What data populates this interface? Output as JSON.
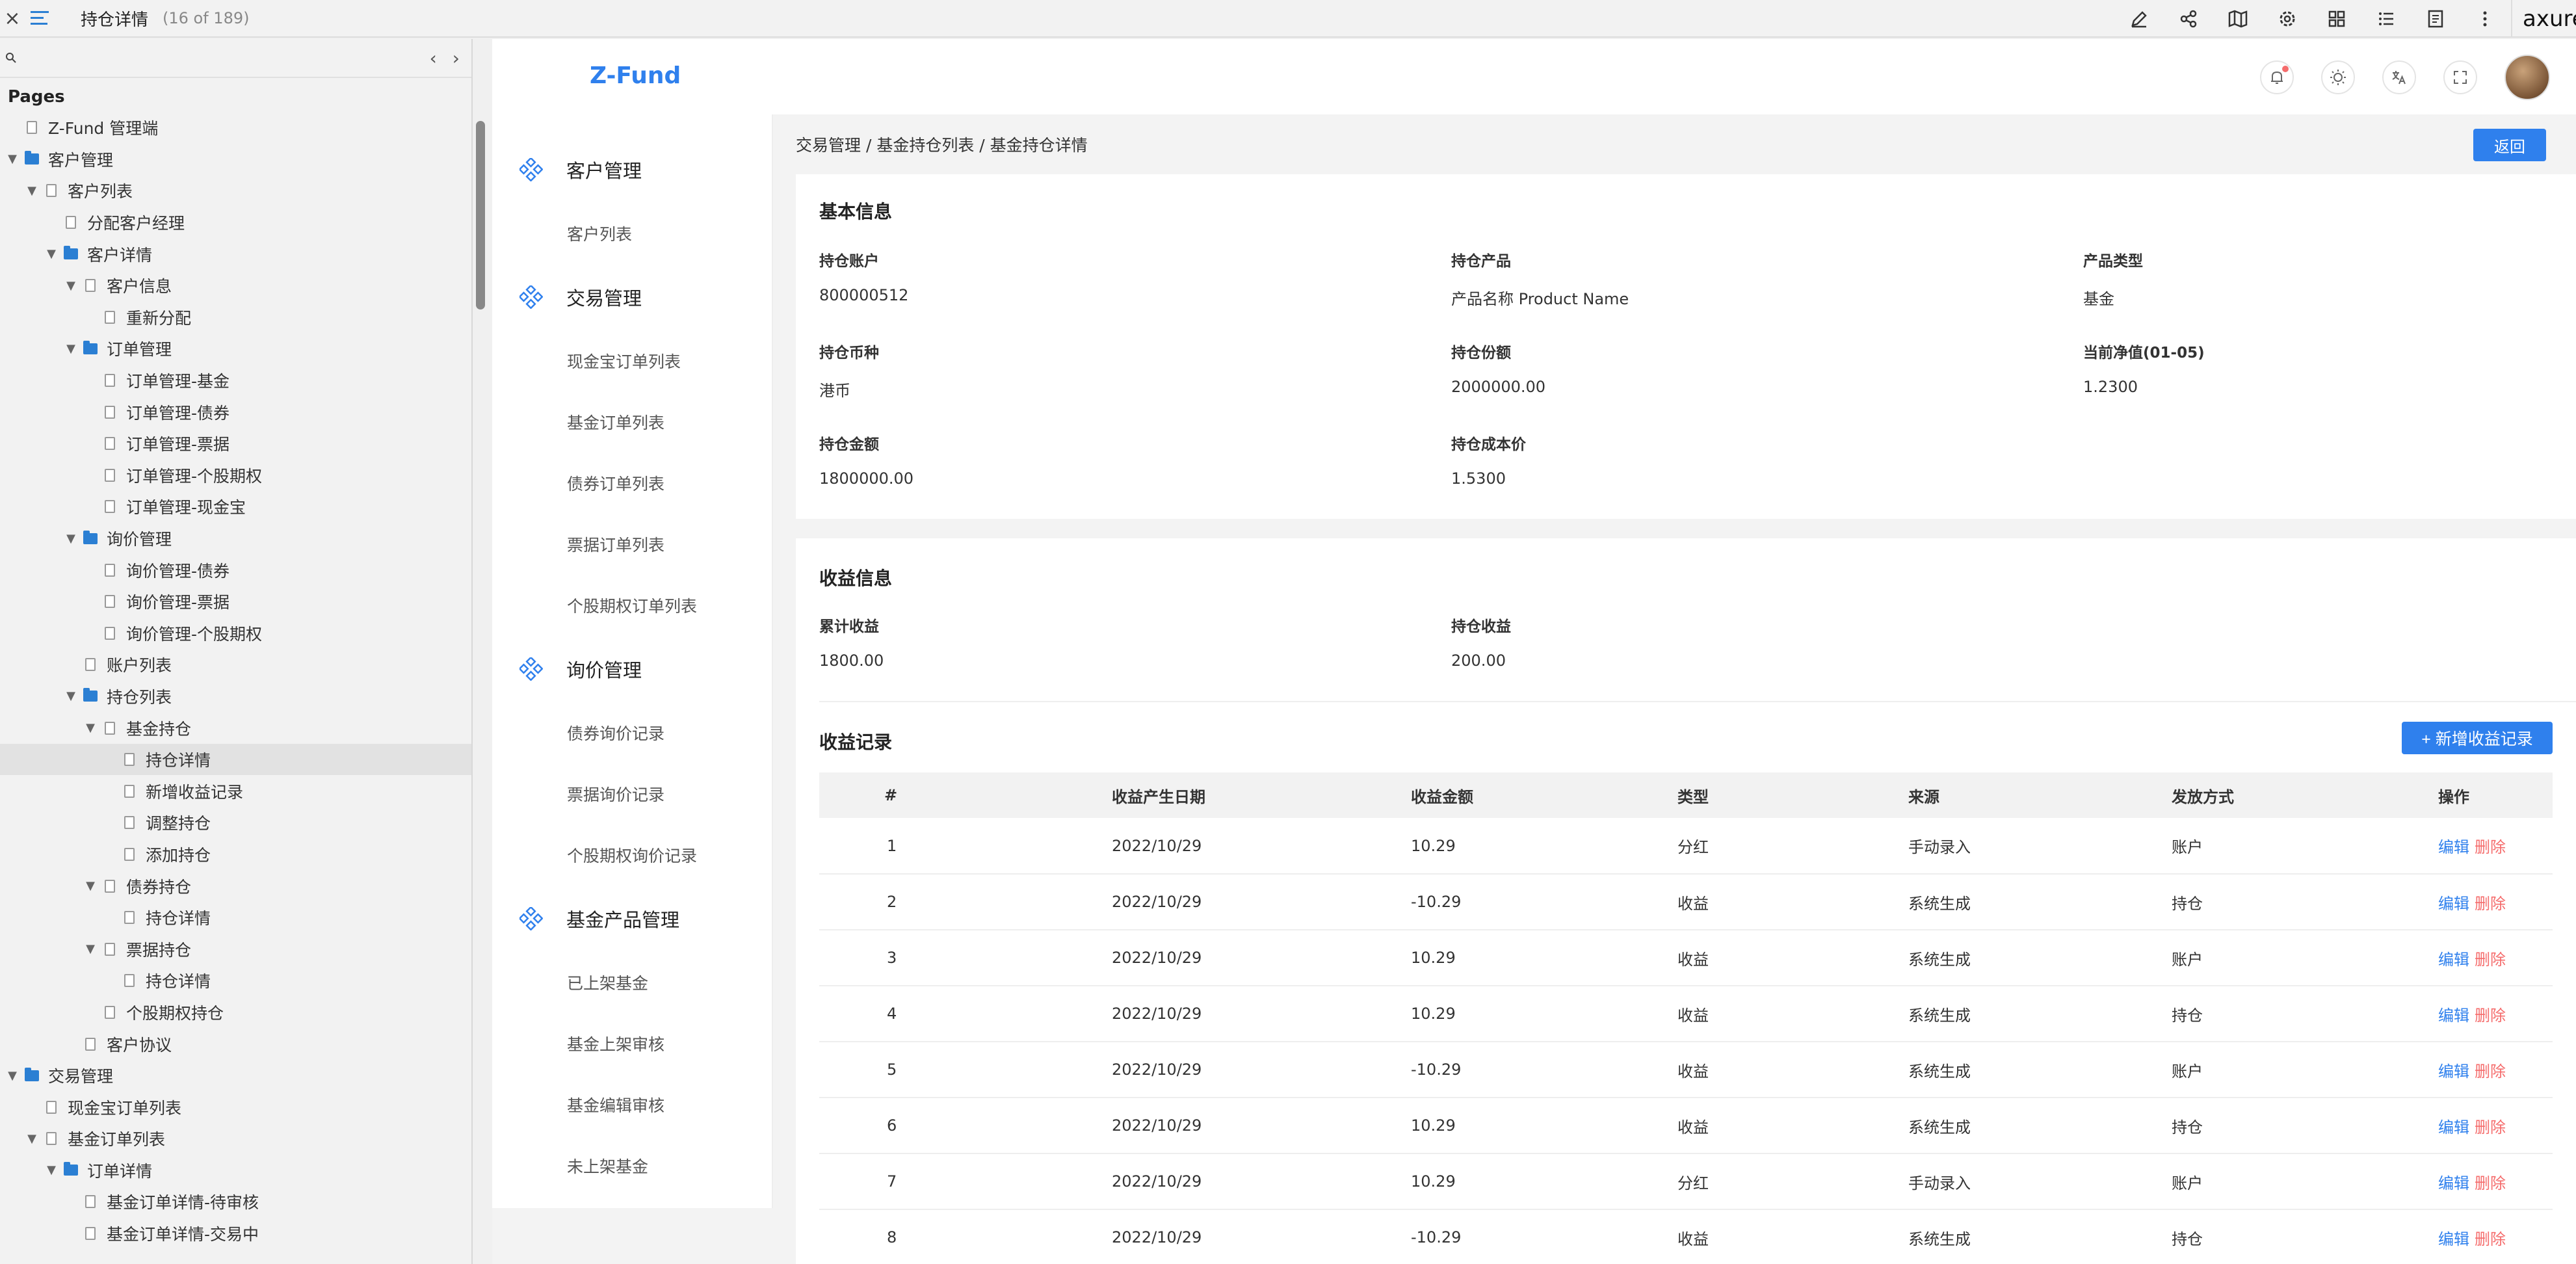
{
  "topbar": {
    "close": "×",
    "title": "持仓详情",
    "count": "(16 of 189)",
    "brand": "axure",
    "tools": [
      "edit-icon",
      "share-icon",
      "map-icon",
      "settings-icon",
      "grid-icon",
      "list-icon",
      "notes-icon",
      "more-icon"
    ]
  },
  "pages_panel": {
    "search_placeholder": "",
    "prev": "‹",
    "next": "›",
    "title": "Pages",
    "tree": [
      {
        "label": "Z-Fund 管理端",
        "depth": 0,
        "type": "page",
        "caret": false
      },
      {
        "label": "客户管理",
        "depth": 0,
        "type": "folder",
        "caret": true
      },
      {
        "label": "客户列表",
        "depth": 1,
        "type": "page",
        "caret": true
      },
      {
        "label": "分配客户经理",
        "depth": 2,
        "type": "page",
        "caret": false
      },
      {
        "label": "客户详情",
        "depth": 2,
        "type": "folder",
        "caret": true
      },
      {
        "label": "客户信息",
        "depth": 3,
        "type": "page",
        "caret": true
      },
      {
        "label": "重新分配",
        "depth": 4,
        "type": "page",
        "caret": false
      },
      {
        "label": "订单管理",
        "depth": 3,
        "type": "folder",
        "caret": true
      },
      {
        "label": "订单管理-基金",
        "depth": 4,
        "type": "page",
        "caret": false
      },
      {
        "label": "订单管理-债券",
        "depth": 4,
        "type": "page",
        "caret": false
      },
      {
        "label": "订单管理-票据",
        "depth": 4,
        "type": "page",
        "caret": false
      },
      {
        "label": "订单管理-个股期权",
        "depth": 4,
        "type": "page",
        "caret": false
      },
      {
        "label": "订单管理-现金宝",
        "depth": 4,
        "type": "page",
        "caret": false
      },
      {
        "label": "询价管理",
        "depth": 3,
        "type": "folder",
        "caret": true
      },
      {
        "label": "询价管理-债券",
        "depth": 4,
        "type": "page",
        "caret": false
      },
      {
        "label": "询价管理-票据",
        "depth": 4,
        "type": "page",
        "caret": false
      },
      {
        "label": "询价管理-个股期权",
        "depth": 4,
        "type": "page",
        "caret": false
      },
      {
        "label": "账户列表",
        "depth": 3,
        "type": "page",
        "caret": false
      },
      {
        "label": "持仓列表",
        "depth": 3,
        "type": "folder",
        "caret": true
      },
      {
        "label": "基金持仓",
        "depth": 4,
        "type": "page",
        "caret": true
      },
      {
        "label": "持仓详情",
        "depth": 5,
        "type": "page",
        "caret": false,
        "selected": true
      },
      {
        "label": "新增收益记录",
        "depth": 5,
        "type": "page",
        "caret": false
      },
      {
        "label": "调整持仓",
        "depth": 5,
        "type": "page",
        "caret": false
      },
      {
        "label": "添加持仓",
        "depth": 5,
        "type": "page",
        "caret": false
      },
      {
        "label": "债券持仓",
        "depth": 4,
        "type": "page",
        "caret": true
      },
      {
        "label": "持仓详情",
        "depth": 5,
        "type": "page",
        "caret": false
      },
      {
        "label": "票据持仓",
        "depth": 4,
        "type": "page",
        "caret": true
      },
      {
        "label": "持仓详情",
        "depth": 5,
        "type": "page",
        "caret": false
      },
      {
        "label": "个股期权持仓",
        "depth": 4,
        "type": "page",
        "caret": false
      },
      {
        "label": "客户协议",
        "depth": 3,
        "type": "page",
        "caret": false
      },
      {
        "label": "交易管理",
        "depth": 0,
        "type": "folder",
        "caret": true
      },
      {
        "label": "现金宝订单列表",
        "depth": 1,
        "type": "page",
        "caret": false
      },
      {
        "label": "基金订单列表",
        "depth": 1,
        "type": "page",
        "caret": true
      },
      {
        "label": "订单详情",
        "depth": 2,
        "type": "folder",
        "caret": true
      },
      {
        "label": "基金订单详情-待审核",
        "depth": 3,
        "type": "page",
        "caret": false
      },
      {
        "label": "基金订单详情-交易中",
        "depth": 3,
        "type": "page",
        "caret": false
      }
    ]
  },
  "app": {
    "logo": "Z-Fund",
    "header_icons": [
      "bell-icon",
      "sun-icon",
      "translate-icon",
      "fullscreen-icon"
    ],
    "menu": [
      {
        "group": "客户管理",
        "items": [
          "客户列表"
        ]
      },
      {
        "group": "交易管理",
        "items": [
          "现金宝订单列表",
          "基金订单列表",
          "债券订单列表",
          "票据订单列表",
          "个股期权订单列表"
        ]
      },
      {
        "group": "询价管理",
        "items": [
          "债券询价记录",
          "票据询价记录",
          "个股期权询价记录"
        ]
      },
      {
        "group": "基金产品管理",
        "items": [
          "已上架基金",
          "基金上架审核",
          "基金编辑审核",
          "未上架基金"
        ]
      }
    ],
    "breadcrumb": "交易管理 / 基金持仓列表 / 基金持仓详情",
    "back_label": "返回",
    "basic": {
      "title": "基本信息",
      "fields": [
        {
          "label": "持仓账户",
          "value": "800000512"
        },
        {
          "label": "持仓产品",
          "value": "产品名称 Product Name"
        },
        {
          "label": "产品类型",
          "value": "基金"
        },
        {
          "label": "持仓币种",
          "value": "港币"
        },
        {
          "label": "持仓份额",
          "value": "2000000.00"
        },
        {
          "label": "当前净值(01-05)",
          "value": "1.2300"
        },
        {
          "label": "持仓金额",
          "value": "1800000.00"
        },
        {
          "label": "持仓成本价",
          "value": "1.5300"
        }
      ]
    },
    "income": {
      "title": "收益信息",
      "fields": [
        {
          "label": "累计收益",
          "value": "1800.00"
        },
        {
          "label": "持仓收益",
          "value": "200.00"
        }
      ]
    },
    "records": {
      "title": "收益记录",
      "add_label": "+ 新增收益记录",
      "columns": [
        "#",
        "收益产生日期",
        "收益金额",
        "类型",
        "来源",
        "发放方式",
        "操作"
      ],
      "edit_label": "编辑",
      "delete_label": "删除",
      "rows": [
        [
          "1",
          "2022/10/29",
          "10.29",
          "分红",
          "手动录入",
          "账户"
        ],
        [
          "2",
          "2022/10/29",
          "-10.29",
          "收益",
          "系统生成",
          "持仓"
        ],
        [
          "3",
          "2022/10/29",
          "10.29",
          "收益",
          "系统生成",
          "账户"
        ],
        [
          "4",
          "2022/10/29",
          "10.29",
          "收益",
          "系统生成",
          "持仓"
        ],
        [
          "5",
          "2022/10/29",
          "-10.29",
          "收益",
          "系统生成",
          "账户"
        ],
        [
          "6",
          "2022/10/29",
          "10.29",
          "收益",
          "系统生成",
          "持仓"
        ],
        [
          "7",
          "2022/10/29",
          "10.29",
          "分红",
          "手动录入",
          "账户"
        ],
        [
          "8",
          "2022/10/29",
          "-10.29",
          "收益",
          "系统生成",
          "持仓"
        ]
      ]
    }
  },
  "colors": {
    "accent": "#2f80ed",
    "danger": "#f56c6c",
    "folder": "#2b7fd3"
  }
}
